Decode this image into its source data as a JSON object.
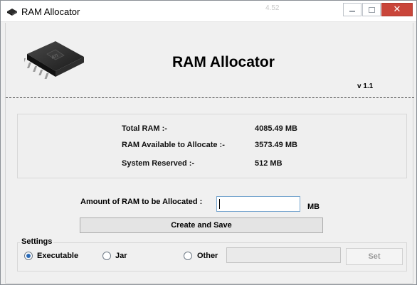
{
  "window": {
    "title": "RAM Allocator",
    "background_ghost_text": "4.52"
  },
  "header": {
    "app_title": "RAM Allocator",
    "version": "v 1.1"
  },
  "ram_info": {
    "total_label": "Total RAM :-",
    "total_value": "4085.49 MB",
    "available_label": "RAM Available to Allocate :-",
    "available_value": "3573.49 MB",
    "reserved_label": "System Reserved :-",
    "reserved_value": "512 MB"
  },
  "allocation": {
    "label": "Amount of RAM to be Allocated :",
    "input_value": "",
    "unit": "MB",
    "create_button": "Create and Save"
  },
  "settings": {
    "legend": "Settings",
    "options": [
      {
        "label": "Executable",
        "checked": true
      },
      {
        "label": "Jar",
        "checked": false
      },
      {
        "label": "Other",
        "checked": false
      }
    ],
    "other_input_value": "",
    "set_button": "Set"
  },
  "colors": {
    "close_button": "#c9453a",
    "radio_selected": "#2a6ab7",
    "input_focus_border": "#7aa7cf"
  },
  "icons": {
    "app_icon": "ram-chip-icon",
    "minimize": "minimize-icon",
    "maximize": "maximize-icon",
    "close": "close-icon"
  }
}
